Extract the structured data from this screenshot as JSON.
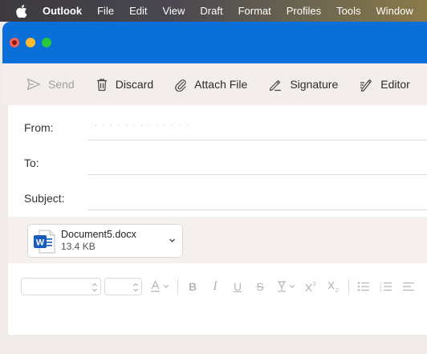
{
  "menubar": {
    "app": "Outlook",
    "items": [
      "File",
      "Edit",
      "View",
      "Draft",
      "Format",
      "Profiles",
      "Tools",
      "Window"
    ]
  },
  "toolbar": {
    "send": "Send",
    "discard": "Discard",
    "attach": "Attach File",
    "signature": "Signature",
    "editor": "Editor"
  },
  "compose": {
    "from_label": "From:",
    "to_label": "To:",
    "subject_label": "Subject:",
    "to_value": "",
    "subject_value": ""
  },
  "attachment": {
    "name": "Document5.docx",
    "size": "13.4 KB",
    "icon": "word-doc-icon"
  },
  "colors": {
    "title_bar": "#0a6fd8",
    "word_blue": "#185abd"
  }
}
